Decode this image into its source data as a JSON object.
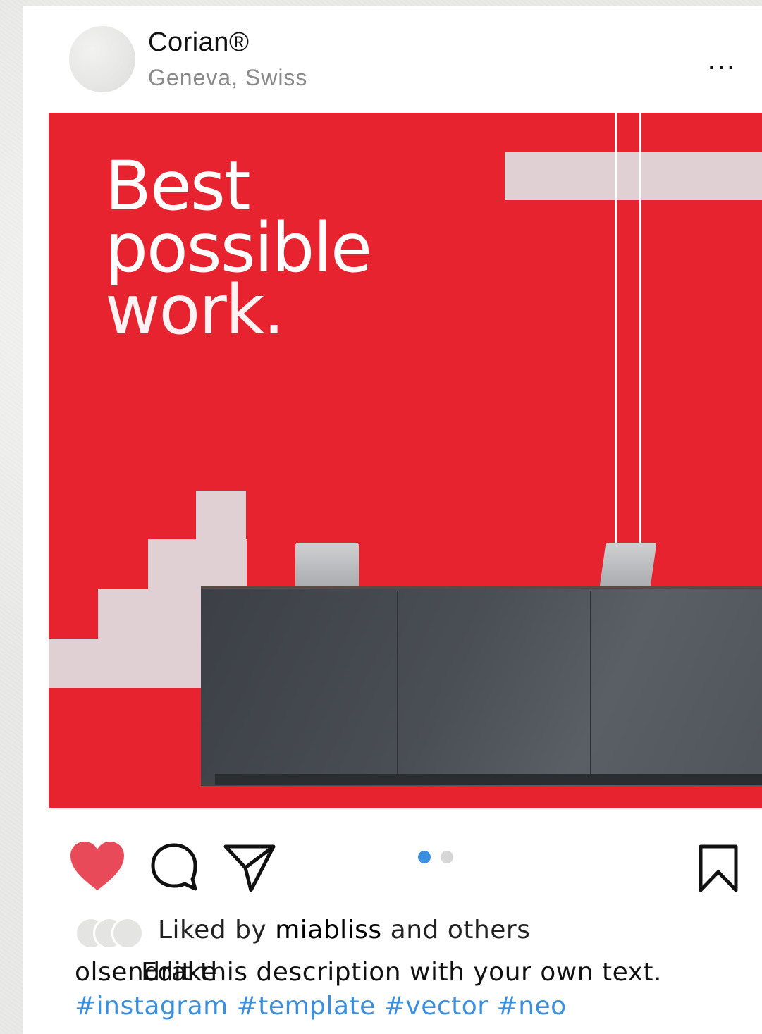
{
  "header": {
    "account_name": "Corian®",
    "location": "Geneva, Swiss",
    "more_label": "..."
  },
  "post": {
    "headline_line1": "Best",
    "headline_line2": "possible",
    "headline_line3": "work."
  },
  "actions": {
    "like_icon": "heart-icon",
    "comment_icon": "comment-icon",
    "share_icon": "send-icon",
    "save_icon": "bookmark-icon",
    "carousel": {
      "count": 2,
      "active": 1
    }
  },
  "likes": {
    "prefix": "Liked by",
    "user": "miabliss",
    "suffix": "and others"
  },
  "caption": {
    "username": "olsendrake",
    "text": "Edit this description with your own text."
  },
  "hashtags": "#instagram #template #vector #neo",
  "colors": {
    "post_background": "#e6232f",
    "accent_pink": "#e0cfd3",
    "like_red": "#e84a5a",
    "hashtag_blue": "#3a8fe0",
    "dot_active": "#3a8fe0",
    "dot_inactive": "#d6d6d6"
  }
}
